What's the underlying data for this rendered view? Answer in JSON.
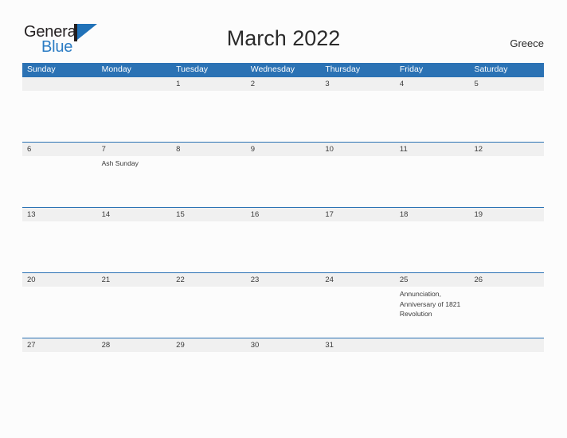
{
  "brand": {
    "name_part1": "General",
    "name_part2": "Blue",
    "flag_icon": "flag-icon"
  },
  "header": {
    "title": "March 2022",
    "country": "Greece"
  },
  "calendar": {
    "month": "March",
    "year": "2022",
    "weekday_headers": [
      "Sunday",
      "Monday",
      "Tuesday",
      "Wednesday",
      "Thursday",
      "Friday",
      "Saturday"
    ],
    "header_bg_color": "#2b72b4",
    "date_band_color": "#f0f0f0",
    "weeks": [
      {
        "days": [
          {
            "num": "",
            "event": ""
          },
          {
            "num": "",
            "event": ""
          },
          {
            "num": "1",
            "event": ""
          },
          {
            "num": "2",
            "event": ""
          },
          {
            "num": "3",
            "event": ""
          },
          {
            "num": "4",
            "event": ""
          },
          {
            "num": "5",
            "event": ""
          }
        ]
      },
      {
        "days": [
          {
            "num": "6",
            "event": ""
          },
          {
            "num": "7",
            "event": "Ash Sunday"
          },
          {
            "num": "8",
            "event": ""
          },
          {
            "num": "9",
            "event": ""
          },
          {
            "num": "10",
            "event": ""
          },
          {
            "num": "11",
            "event": ""
          },
          {
            "num": "12",
            "event": ""
          }
        ]
      },
      {
        "days": [
          {
            "num": "13",
            "event": ""
          },
          {
            "num": "14",
            "event": ""
          },
          {
            "num": "15",
            "event": ""
          },
          {
            "num": "16",
            "event": ""
          },
          {
            "num": "17",
            "event": ""
          },
          {
            "num": "18",
            "event": ""
          },
          {
            "num": "19",
            "event": ""
          }
        ]
      },
      {
        "days": [
          {
            "num": "20",
            "event": ""
          },
          {
            "num": "21",
            "event": ""
          },
          {
            "num": "22",
            "event": ""
          },
          {
            "num": "23",
            "event": ""
          },
          {
            "num": "24",
            "event": ""
          },
          {
            "num": "25",
            "event": "Annunciation, Anniversary of 1821 Revolution"
          },
          {
            "num": "26",
            "event": ""
          }
        ]
      },
      {
        "days": [
          {
            "num": "27",
            "event": ""
          },
          {
            "num": "28",
            "event": ""
          },
          {
            "num": "29",
            "event": ""
          },
          {
            "num": "30",
            "event": ""
          },
          {
            "num": "31",
            "event": ""
          },
          {
            "num": "",
            "event": ""
          },
          {
            "num": "",
            "event": ""
          }
        ]
      }
    ]
  }
}
